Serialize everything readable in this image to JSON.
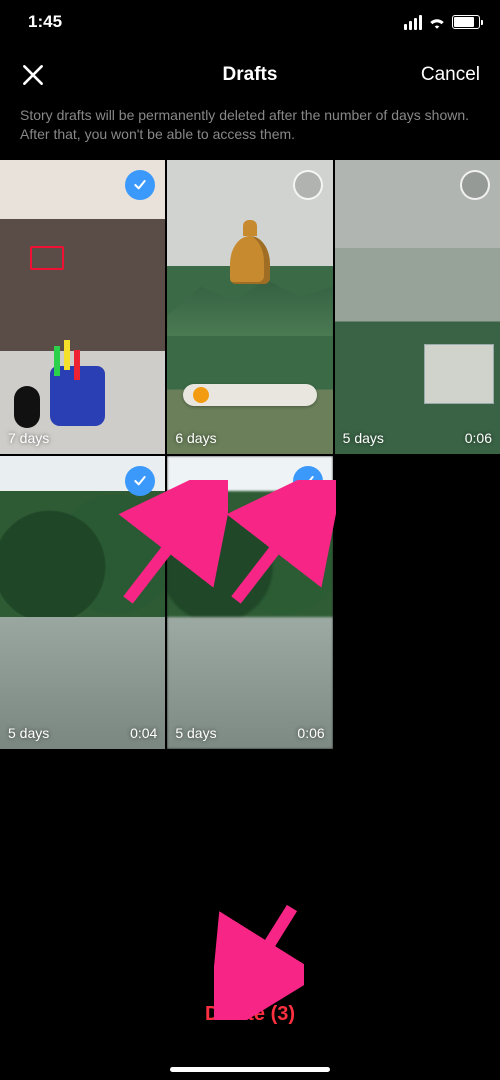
{
  "statusbar": {
    "time": "1:45"
  },
  "navbar": {
    "title": "Drafts",
    "cancel": "Cancel"
  },
  "subtitle": "Story drafts will be permanently deleted after the number of days shown. After that, you won't be able to access them.",
  "drafts": [
    {
      "days": "7 days",
      "duration": "",
      "selected": true
    },
    {
      "days": "6 days",
      "duration": "",
      "selected": false
    },
    {
      "days": "5 days",
      "duration": "0:06",
      "selected": false
    },
    {
      "days": "5 days",
      "duration": "0:04",
      "selected": true
    },
    {
      "days": "5 days",
      "duration": "0:06",
      "selected": true
    }
  ],
  "delete_label": "Delete (3)",
  "colors": {
    "accent_blue": "#3b99fc",
    "destructive": "#ff3040",
    "annotation": "#f72585"
  }
}
